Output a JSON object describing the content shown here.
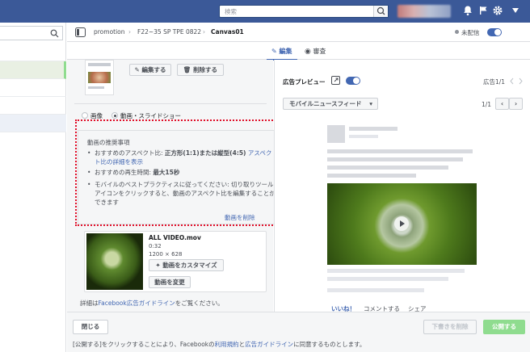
{
  "topbar": {
    "search_placeholder": "検索"
  },
  "breadcrumb": {
    "item1": "promotion",
    "item2": "F22~35 SP TPE 0822",
    "item3": "Canvas01"
  },
  "status": {
    "label": "未配信"
  },
  "tabs": {
    "edit": "編集",
    "review": "審査"
  },
  "editor": {
    "edit_button": "編集する",
    "delete_button": "削除する",
    "radio_image": "画像",
    "radio_video": "動画・スライドショー",
    "rec_title": "動画の推奨事項",
    "rec1_prefix": "おすすめのアスペクト比: ",
    "rec1_bold": "正方形(1:1)または縦型(4:5)",
    "rec1_link": "アスペクト比の詳細を表示",
    "rec2_prefix": "おすすめの再生時間: ",
    "rec2_bold": "最大15秒",
    "rec3": "モバイルのベストプラクティスに従ってください: 切り取りツールアイコンをクリックすると、動画のアスペクト比を編集することができます",
    "delete_video_link": "動画を削除",
    "video_name": "ALL VIDEO.mov",
    "video_duration": "0:32",
    "video_size": "1200 × 628",
    "customize_button": "動画をカスタマイズ",
    "change_button": "動画を変更",
    "guide_prefix": "詳細は",
    "guide_link": "Facebook広告ガイドライン",
    "guide_suffix": "をご覧ください。"
  },
  "preview": {
    "title": "広告プレビュー",
    "ad_count": "広告1/1",
    "placement": "モバイルニュースフィード",
    "page_count": "1/1",
    "like": "いいね！",
    "comment": "コメントする",
    "share": "シェア"
  },
  "footer": {
    "close_button": "閉じる",
    "delete_draft_button": "下書きを削除",
    "publish_button": "公開する",
    "notice_prefix": "[公開する]をクリックすることにより、Facebookの",
    "notice_link1": "利用規約",
    "notice_mid": "と",
    "notice_link2": "広告ガイドライン",
    "notice_suffix": "に同意するものとします。"
  },
  "colors": {
    "brand": "#3b5998",
    "accent": "#4267b2",
    "publish": "#8fdc8f",
    "highlight": "#e0102a"
  }
}
